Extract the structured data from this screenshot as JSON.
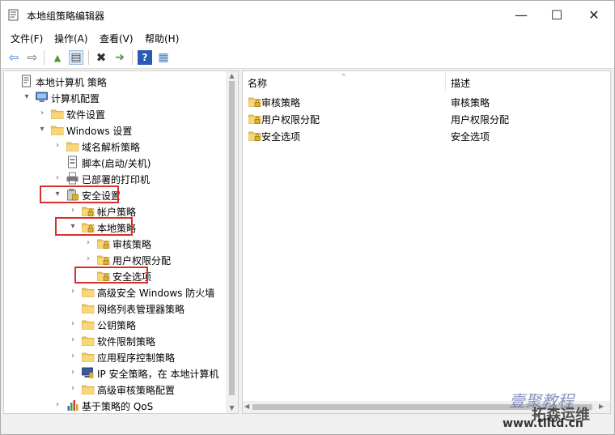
{
  "window": {
    "title": "本地组策略编辑器",
    "min_glyph": "—",
    "max_glyph": "☐",
    "close_glyph": "✕"
  },
  "menu": [
    "文件(F)",
    "操作(A)",
    "查看(V)",
    "帮助(H)"
  ],
  "toolbar": {
    "icons": [
      "back-arrow-icon",
      "forward-arrow-icon",
      "folder-up-icon",
      "show-hide-tree-icon",
      "delete-icon",
      "export-list-icon",
      "help-icon",
      "properties-icon"
    ],
    "glyphs": [
      "⇦",
      "⇨",
      "▲",
      "▤",
      "✖",
      "➔",
      "?",
      "▦"
    ]
  },
  "tree": [
    {
      "label": "本地计算机 策略",
      "indent": 0,
      "arrow": "",
      "icon": "policy-icon"
    },
    {
      "label": "计算机配置",
      "indent": 1,
      "arrow": "▾",
      "icon": "computer-icon"
    },
    {
      "label": "软件设置",
      "indent": 2,
      "arrow": "›",
      "icon": "folder-icon"
    },
    {
      "label": "Windows 设置",
      "indent": 2,
      "arrow": "▾",
      "icon": "folder-icon"
    },
    {
      "label": "域名解析策略",
      "indent": 3,
      "arrow": "›",
      "icon": "folder-icon"
    },
    {
      "label": "脚本(启动/关机)",
      "indent": 3,
      "arrow": "",
      "icon": "script-icon"
    },
    {
      "label": "已部署的打印机",
      "indent": 3,
      "arrow": "›",
      "icon": "printer-icon"
    },
    {
      "label": "安全设置",
      "indent": 3,
      "arrow": "▾",
      "icon": "security-settings-icon"
    },
    {
      "label": "帐户策略",
      "indent": 4,
      "arrow": "›",
      "icon": "folder-lock-icon"
    },
    {
      "label": "本地策略",
      "indent": 4,
      "arrow": "▾",
      "icon": "folder-lock-icon"
    },
    {
      "label": "审核策略",
      "indent": 5,
      "arrow": "›",
      "icon": "folder-lock-icon"
    },
    {
      "label": "用户权限分配",
      "indent": 5,
      "arrow": "›",
      "icon": "folder-lock-icon"
    },
    {
      "label": "安全选项",
      "indent": 5,
      "arrow": "",
      "icon": "folder-lock-icon"
    },
    {
      "label": "高级安全 Windows 防火墙",
      "indent": 4,
      "arrow": "›",
      "icon": "folder-icon"
    },
    {
      "label": "网络列表管理器策略",
      "indent": 4,
      "arrow": "",
      "icon": "folder-icon"
    },
    {
      "label": "公钥策略",
      "indent": 4,
      "arrow": "›",
      "icon": "folder-icon"
    },
    {
      "label": "软件限制策略",
      "indent": 4,
      "arrow": "›",
      "icon": "folder-icon"
    },
    {
      "label": "应用程序控制策略",
      "indent": 4,
      "arrow": "›",
      "icon": "folder-icon"
    },
    {
      "label": "IP 安全策略，在 本地计算机",
      "indent": 4,
      "arrow": "›",
      "icon": "ip-security-icon"
    },
    {
      "label": "高级审核策略配置",
      "indent": 4,
      "arrow": "›",
      "icon": "folder-icon"
    },
    {
      "label": "基于策略的 QoS",
      "indent": 3,
      "arrow": "›",
      "icon": "chart-icon"
    }
  ],
  "list": {
    "headers": {
      "name": "名称",
      "desc": "描述",
      "sort_glyph": "⌃"
    },
    "rows": [
      {
        "name": "审核策略",
        "desc": "审核策略"
      },
      {
        "name": "用户权限分配",
        "desc": "用户权限分配"
      },
      {
        "name": "安全选项",
        "desc": "安全选项"
      }
    ]
  },
  "scroll_glyphs": {
    "up": "▲",
    "down": "▼",
    "left": "◀",
    "right": "▶"
  },
  "watermark": {
    "line1": "壹聚教程",
    "line2": "拓森运维",
    "line3": "www.tlltd.cn"
  },
  "colors": {
    "highlight": "#d9302c",
    "folder": "#f2c552",
    "selection": "#cce8ff"
  }
}
